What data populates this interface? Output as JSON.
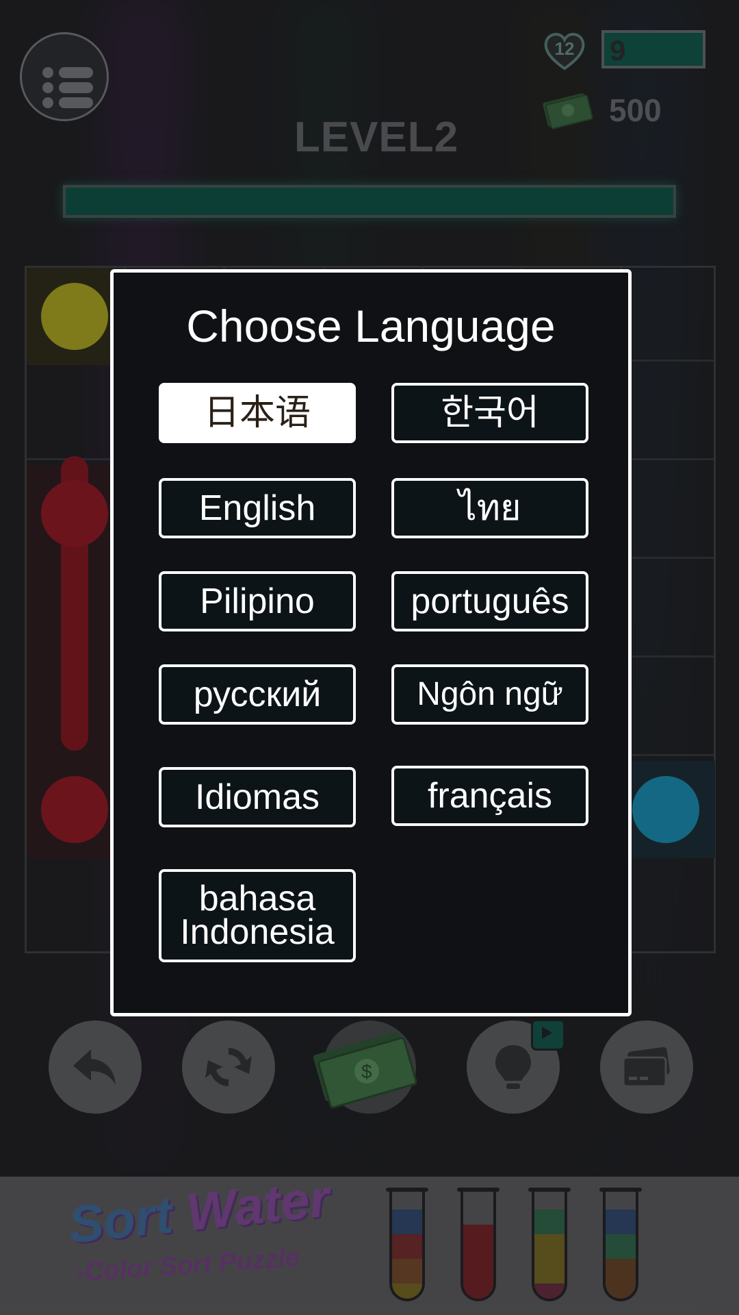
{
  "hud": {
    "lives": "12",
    "energy": "9",
    "cash": "500",
    "level_title": "LEVEL2"
  },
  "colors": {
    "accent_green": "#0b5a4a",
    "node_yellow": "#b8b11c",
    "node_red": "#9c1420",
    "node_blue": "#1596be",
    "node_green": "#1f6e2c",
    "dialog_border": "#ffffff",
    "selected_bg": "#ffffff"
  },
  "dialog": {
    "title": "Choose Language",
    "languages": [
      {
        "label": "日本语",
        "selected": true
      },
      {
        "label": "한국어",
        "selected": false
      },
      {
        "label": "English",
        "selected": false
      },
      {
        "label": "ไทย",
        "selected": false
      },
      {
        "label": "Pilipino",
        "selected": false
      },
      {
        "label": "português",
        "selected": false
      },
      {
        "label": "русский",
        "selected": false
      },
      {
        "label": "Ngôn ngữ",
        "selected": false
      },
      {
        "label": "Idiomas",
        "selected": false
      },
      {
        "label": "français",
        "selected": false
      },
      {
        "label": "bahasa Indonesia",
        "selected": false
      }
    ]
  },
  "tools": [
    {
      "icon": "undo-icon"
    },
    {
      "icon": "restart-icon"
    },
    {
      "icon": "cash-icon"
    },
    {
      "icon": "hint-bulb-icon"
    },
    {
      "icon": "card-icon"
    }
  ],
  "banner": {
    "title_part1": "Sort",
    "title_part2": "Water",
    "subtitle": "-Color Sort Puzzle"
  }
}
